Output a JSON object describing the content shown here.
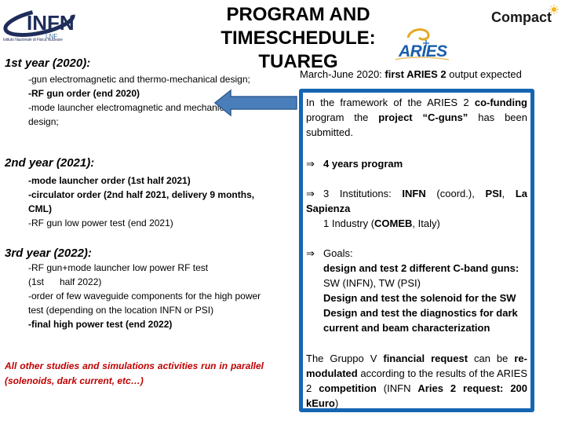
{
  "header": {
    "title_line1": "PROGRAM AND TIMESCHEDULE:",
    "title_line2": "TUAREG",
    "logos": {
      "infn": {
        "main": "INFN",
        "sub": "LNF",
        "caption": "Istituto Nazionale di Fisica Nucleare"
      },
      "aries": {
        "word": "ARIES"
      },
      "compact": {
        "word": "Compact"
      }
    }
  },
  "left": {
    "years": [
      {
        "heading": "1st year (2020):",
        "items": [
          {
            "text": "-gun electromagnetic and thermo-mechanical design;",
            "bold": false
          },
          {
            "text": "-RF gun order (end 2020)",
            "bold": true
          },
          {
            "text": "-mode launcher electromagnetic and mechanical design;",
            "bold": false
          }
        ]
      },
      {
        "heading": "2nd year (2021):",
        "items": [
          {
            "text": "-mode launcher order (1st half 2021)",
            "bold": true
          },
          {
            "text": "-circulator order (2nd half 2021, delivery 9 months, CML)",
            "bold": true
          },
          {
            "text": "-RF gun low power test (end 2021)",
            "bold": false
          }
        ]
      },
      {
        "heading": "3rd year (2022):",
        "items": [
          {
            "text": "-RF gun+mode launcher low power RF test",
            "bold": false
          },
          {
            "text": "(1st      half 2022)",
            "bold": false
          },
          {
            "text": "-order of few waveguide components for the high power test  (depending on the location INFN or PSI)",
            "bold": false
          },
          {
            "text": "-final high power test (end 2022)",
            "bold": true
          }
        ]
      }
    ],
    "note": "All other studies and simulations activities run in parallel (solenoids, dark current, etc…)"
  },
  "right": {
    "aries_expected": {
      "prefix": "March-June 2020: ",
      "bold": "first ARIES 2",
      "suffix": " output expected"
    },
    "cofunding": {
      "t1": "In the framework of the ARIES 2 ",
      "b1": "co-funding",
      "t2": " program the ",
      "b2": "project “C-guns”",
      "t3": " has been submitted."
    },
    "implies_symbol": "⇒",
    "four_years": "4 years program",
    "institutions": {
      "t1": "3 Institutions: ",
      "b1": "INFN",
      "t2": " (coord.), ",
      "b2": "PSI",
      "t3": ", ",
      "b3": "La Sapienza",
      "industry_t1": "1 Industry (",
      "industry_b": "COMEB",
      "industry_t2": ", Italy)"
    },
    "goals": {
      "label": "Goals:",
      "line1": "design and test 2 different C-band guns:",
      "line2": "SW (INFN), TW (PSI)",
      "line3": "Design and test the solenoid for the SW",
      "line4": "Design and test the diagnostics for dark current and beam  characterization"
    },
    "financial": {
      "t1": "The Gruppo V ",
      "b1": "financial request",
      "t2": " can be ",
      "b2": "re-modulated",
      "t3": " according to the results of the ARIES 2 ",
      "b3": "competition",
      "t4": " (INFN ",
      "b4": "Aries 2 request:",
      "t5": " ",
      "b5": "200 kEuro",
      "t6": ")"
    }
  },
  "colors": {
    "box_border": "#1565b3",
    "arrow_fill": "#4a7ebb",
    "note_red": "#c00000",
    "infn_blue": "#1e2d5a",
    "aries_blue": "#1b5eab",
    "aries_gold": "#e5a823"
  }
}
